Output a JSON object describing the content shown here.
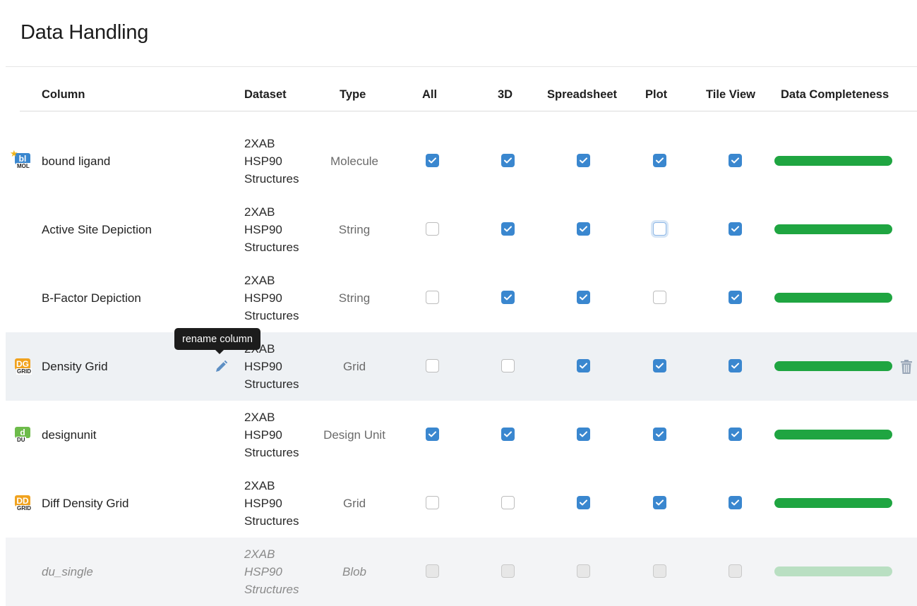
{
  "page": {
    "title": "Data Handling"
  },
  "headers": {
    "column": "Column",
    "dataset": "Dataset",
    "type": "Type",
    "all": "All",
    "three_d": "3D",
    "spreadsheet": "Spreadsheet",
    "plot": "Plot",
    "tile_view": "Tile View",
    "completeness": "Data Completeness"
  },
  "tooltip": {
    "text": "rename column"
  },
  "rows": [
    {
      "name": "bound ligand",
      "icon": "molecule-icon",
      "icon_letters": "bl",
      "icon_sub": "MOL",
      "icon_color": "#3a87cf",
      "starred": true,
      "dataset": [
        "2XAB",
        "HSP90",
        "Structures"
      ],
      "type": "Molecule",
      "all": true,
      "three_d": true,
      "spreadsheet": true,
      "plot": true,
      "tile_view": true,
      "completeness": 1.0
    },
    {
      "name": "Active Site Depiction",
      "icon": "",
      "dataset": [
        "2XAB",
        "HSP90",
        "Structures"
      ],
      "type": "String",
      "all": false,
      "three_d": true,
      "spreadsheet": true,
      "plot": false,
      "tile_view": true,
      "completeness": 1.0
    },
    {
      "name": "B-Factor Depiction",
      "icon": "",
      "dataset": [
        "2XAB",
        "HSP90",
        "Structures"
      ],
      "type": "String",
      "all": false,
      "three_d": true,
      "spreadsheet": true,
      "plot": false,
      "tile_view": true,
      "completeness": 1.0
    },
    {
      "name": "Density Grid",
      "icon": "grid-icon",
      "icon_letters": "DG",
      "icon_sub": "GRID",
      "icon_color": "#f0a21e",
      "dataset": [
        "2XAB",
        "HSP90",
        "Structures"
      ],
      "type": "Grid",
      "all": false,
      "three_d": false,
      "spreadsheet": true,
      "plot": true,
      "tile_view": true,
      "completeness": 1.0
    },
    {
      "name": "designunit",
      "icon": "design-unit-icon",
      "icon_letters": "d",
      "icon_sub": "DU",
      "icon_color": "#6dbb4a",
      "dataset": [
        "2XAB",
        "HSP90",
        "Structures"
      ],
      "type": "Design Unit",
      "all": true,
      "three_d": true,
      "spreadsheet": true,
      "plot": true,
      "tile_view": true,
      "completeness": 1.0
    },
    {
      "name": "Diff Density Grid",
      "icon": "grid-icon",
      "icon_letters": "DD",
      "icon_sub": "GRID",
      "icon_color": "#f0a21e",
      "dataset": [
        "2XAB",
        "HSP90",
        "Structures"
      ],
      "type": "Grid",
      "all": false,
      "three_d": false,
      "spreadsheet": true,
      "plot": true,
      "tile_view": true,
      "completeness": 1.0
    },
    {
      "name": "du_single",
      "icon": "",
      "dataset": [
        "2XAB",
        "HSP90",
        "Structures"
      ],
      "type": "Blob",
      "all": false,
      "three_d": false,
      "spreadsheet": false,
      "plot": false,
      "tile_view": false,
      "completeness": 1.0,
      "disabled": true
    }
  ]
}
